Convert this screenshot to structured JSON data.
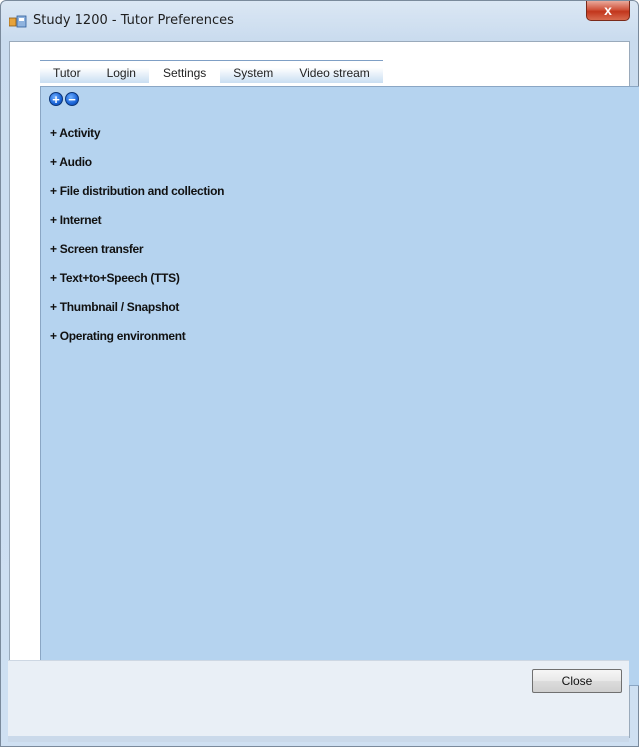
{
  "window": {
    "title": "Study 1200 - Tutor Preferences",
    "close_glyph": "x"
  },
  "tabs": [
    {
      "label": "Tutor"
    },
    {
      "label": "Login"
    },
    {
      "label": "Settings"
    },
    {
      "label": "System"
    },
    {
      "label": "Video stream"
    }
  ],
  "active_tab": "Settings",
  "toolbar": {
    "expand_glyph": "+",
    "collapse_glyph": "−"
  },
  "sections": [
    {
      "label": "+ Activity"
    },
    {
      "label": "+ Audio"
    },
    {
      "label": "+ File distribution and collection"
    },
    {
      "label": "+ Internet"
    },
    {
      "label": "+ Screen transfer"
    },
    {
      "label": "+ Text+to+Speech (TTS)"
    },
    {
      "label": "+ Thumbnail / Snapshot"
    },
    {
      "label": "+ Operating environment"
    }
  ],
  "footer": {
    "close_label": "Close"
  },
  "colors": {
    "panel_background": "#b5d3ef",
    "window_chrome": "#cfe0f2",
    "close_x_red": "#c2361c",
    "circle_button_blue": "#1a64d8"
  }
}
